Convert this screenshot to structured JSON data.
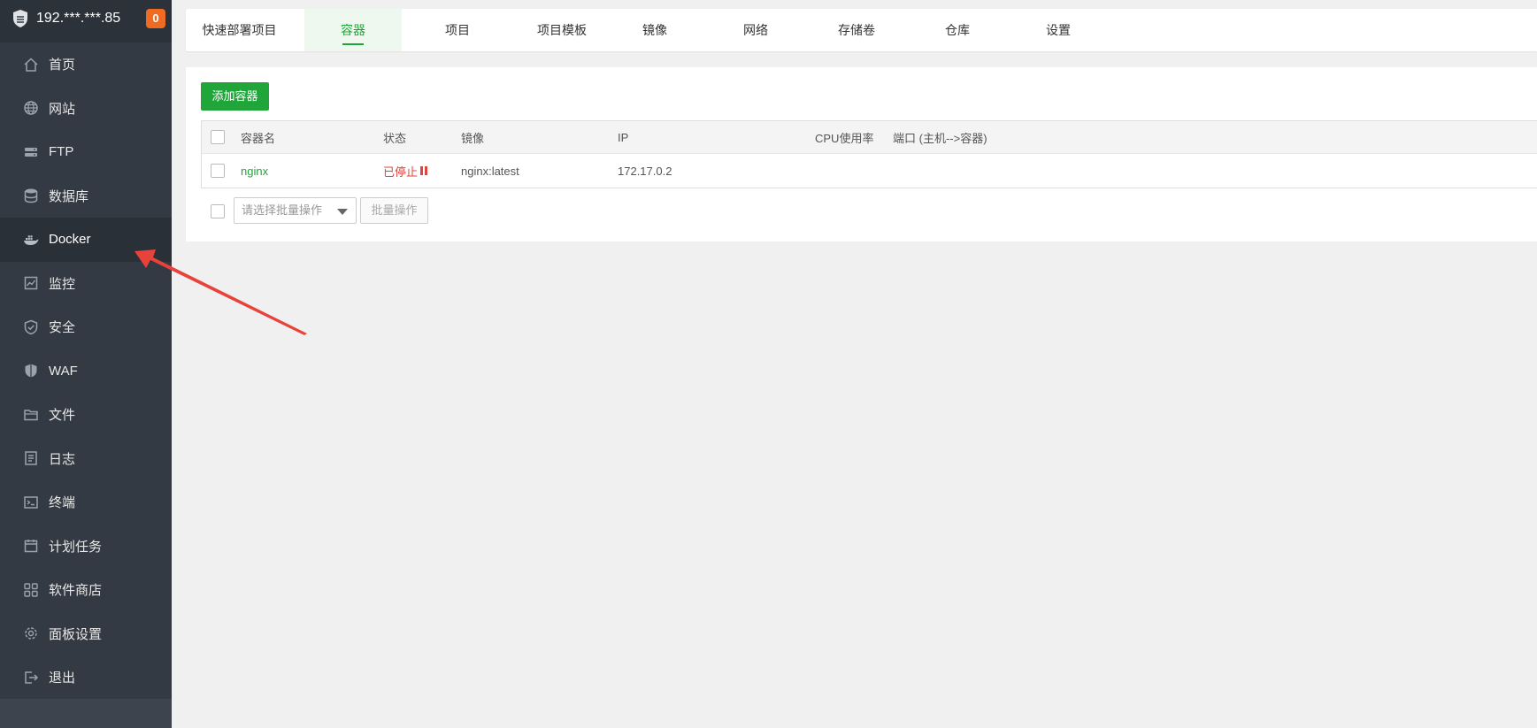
{
  "sidebar": {
    "host": "192.***.***.85",
    "badge": "0",
    "items": [
      {
        "label": "首页",
        "icon": "home-icon"
      },
      {
        "label": "网站",
        "icon": "globe-icon"
      },
      {
        "label": "FTP",
        "icon": "ftp-icon"
      },
      {
        "label": "数据库",
        "icon": "database-icon"
      },
      {
        "label": "Docker",
        "icon": "docker-icon"
      },
      {
        "label": "监控",
        "icon": "monitor-icon"
      },
      {
        "label": "安全",
        "icon": "shield-check-icon"
      },
      {
        "label": "WAF",
        "icon": "waf-shield-icon"
      },
      {
        "label": "文件",
        "icon": "folder-icon"
      },
      {
        "label": "日志",
        "icon": "log-icon"
      },
      {
        "label": "终端",
        "icon": "terminal-icon"
      },
      {
        "label": "计划任务",
        "icon": "calendar-icon"
      },
      {
        "label": "软件商店",
        "icon": "apps-grid-icon"
      },
      {
        "label": "面板设置",
        "icon": "gear-icon"
      },
      {
        "label": "退出",
        "icon": "logout-icon"
      }
    ],
    "active_index": 4
  },
  "tabs": [
    {
      "label": "快速部署项目"
    },
    {
      "label": "容器"
    },
    {
      "label": "项目"
    },
    {
      "label": "项目模板"
    },
    {
      "label": "镜像"
    },
    {
      "label": "网络"
    },
    {
      "label": "存储卷"
    },
    {
      "label": "仓库"
    },
    {
      "label": "设置"
    }
  ],
  "active_tab": 1,
  "toolbar": {
    "add_label": "添加容器"
  },
  "table": {
    "columns": [
      "容器名",
      "状态",
      "镜像",
      "IP",
      "CPU使用率",
      "端口 (主机-->容器)"
    ],
    "rows": [
      {
        "name": "nginx",
        "status": "已停止",
        "image": "nginx:latest",
        "ip": "172.17.0.2",
        "cpu": "",
        "ports": ""
      }
    ]
  },
  "batch": {
    "select_placeholder": "请选择批量操作",
    "button_label": "批量操作"
  },
  "colors": {
    "accent": "#20a53a",
    "sidebar": "#343a43",
    "stopped": "#e0443f",
    "badge": "#ef6b22",
    "annotation": "#e8423b"
  }
}
